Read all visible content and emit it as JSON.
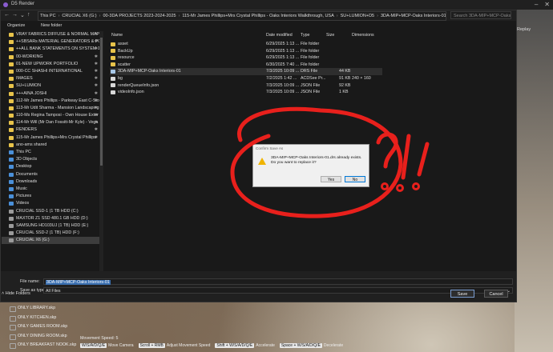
{
  "app": {
    "title": "D5 Render",
    "replay_label": "Replay"
  },
  "address": {
    "crumbs": [
      "This PC",
      "CRUCIAL X6 (G:)",
      "00-3DA PROJECTS 2023-2024-2025",
      "115-Mr James Phillips+Mrs Crystal Phillips - Oaks Interiors Walkthrough, USA",
      "SU+LUMION+D5",
      "3DA-MIP+MCP-Oaks Interiors-01"
    ],
    "search_placeholder": "Search 3DA-MIP+MCP-Oaks Int..."
  },
  "toolbar": {
    "organize": "Organize",
    "new_folder": "New folder"
  },
  "sidebar": {
    "pinned": [
      "VRAY FABRICS DIFFUSE & NORMAL MAPS",
      "++SBSARs MATERIAL GENERATORS & POLI",
      "++ALL BANK STATEMENTS ON SYSTEM-1",
      "00-WORKING",
      "01-NEW UPWORK PORTFOLIO",
      "000-CC SHASHI INTERNATIONAL",
      "IMAGES",
      "SU+LUMION",
      "+++AINA JOSHI",
      "112-Mr James Phillips - Parkway East C-Sto",
      "113-Mr Udit Sharma - Mansion Landscaping",
      "110-Ms Regina Tamposi - Own House Exter",
      "114-Mr Will (Mr Dan Fossitt-Mr Kyle) - Vega",
      "RENDERS",
      "115-Mr James Phillips+Mrs Crystal Phillips",
      "ano-ams shared"
    ],
    "this_pc": "This PC",
    "system": [
      "3D Objects",
      "Desktop",
      "Documents",
      "Downloads",
      "Music",
      "Pictures",
      "Videos"
    ],
    "drives": [
      "CRUCIAL SSD-1 (1 TB HDD (C:)",
      "MAXTOR Z1 SSD 480.1 GB HDD (D:)",
      "SAMSUNG HD103UJ (1 TB) HDD (E:)",
      "CRUCIAL SSD-2 (1 TB) HDD (F:)",
      "CRUCIAL X6 (G:)"
    ]
  },
  "filelist": {
    "columns": [
      "Name",
      "Date modified",
      "Type",
      "Size",
      "Dimensions"
    ],
    "rows": [
      {
        "name": "asset",
        "date": "6/29/2025 1:13 ...",
        "type": "File folder",
        "size": "",
        "dims": "",
        "kind": "folder"
      },
      {
        "name": "BackUp",
        "date": "6/29/2025 1:13 ...",
        "type": "File folder",
        "size": "",
        "dims": "",
        "kind": "folder"
      },
      {
        "name": "resource",
        "date": "6/29/2025 1:13 ...",
        "type": "File folder",
        "size": "",
        "dims": "",
        "kind": "folder"
      },
      {
        "name": "scatter",
        "date": "6/30/2025 7:40 ...",
        "type": "File folder",
        "size": "",
        "dims": "",
        "kind": "folder"
      },
      {
        "name": "3DA-MIP+MCP-Oaks Interiors-01",
        "date": "7/3/2025 10:09 ...",
        "type": "DRS File",
        "size": "44 KB",
        "dims": "",
        "kind": "drs"
      },
      {
        "name": "bg",
        "date": "7/2/2025 1:42 ...",
        "type": "ACDSee Pr...",
        "size": "91 KB",
        "dims": "240 × 160",
        "kind": "file"
      },
      {
        "name": "renderQueueInfo.json",
        "date": "7/3/2025 10:09 ...",
        "type": "JSON File",
        "size": "92 KB",
        "dims": "",
        "kind": "file"
      },
      {
        "name": "videoInfo.json",
        "date": "7/3/2025 10:09 ...",
        "type": "JSON File",
        "size": "1 KB",
        "dims": "",
        "kind": "file"
      }
    ]
  },
  "bottom": {
    "file_name_label": "File name:",
    "file_name_value": "3DA-MIP+MCP-Oaks Interiors-01",
    "save_type_label": "Save as type:",
    "save_type_value": "All Files",
    "hide_folders": "Hide Folders",
    "save": "Save",
    "cancel": "Cancel"
  },
  "confirm": {
    "title": "Confirm Save As",
    "line1": "3DA-MIP+MCP-Oaks Interiors-01.drs already exists.",
    "line2": "Do you want to replace it?",
    "yes": "Yes",
    "no": "No"
  },
  "scene": {
    "list": [
      "ONLY LIBRARY.skp",
      "ONLY KITCHEN.skp",
      "ONLY GAMES ROOM.skp",
      "ONLY DINING ROOM.skp",
      "ONLY BREAKFAST NOOK.skp"
    ],
    "speed": "Movement Speed: 5",
    "hints": [
      {
        "key": "W/S/A/D/Q/E",
        "label": "Move Camera"
      },
      {
        "key": "Scroll + RMB",
        "label": "Adjust Movement Speed"
      },
      {
        "key": "Shift + W/S/A/D/Q/E",
        "label": "Accelerate"
      },
      {
        "key": "Space + W/S/A/D/Q/E",
        "label": "Decelerate"
      }
    ]
  },
  "annotation": {
    "color": "#e8201c"
  }
}
